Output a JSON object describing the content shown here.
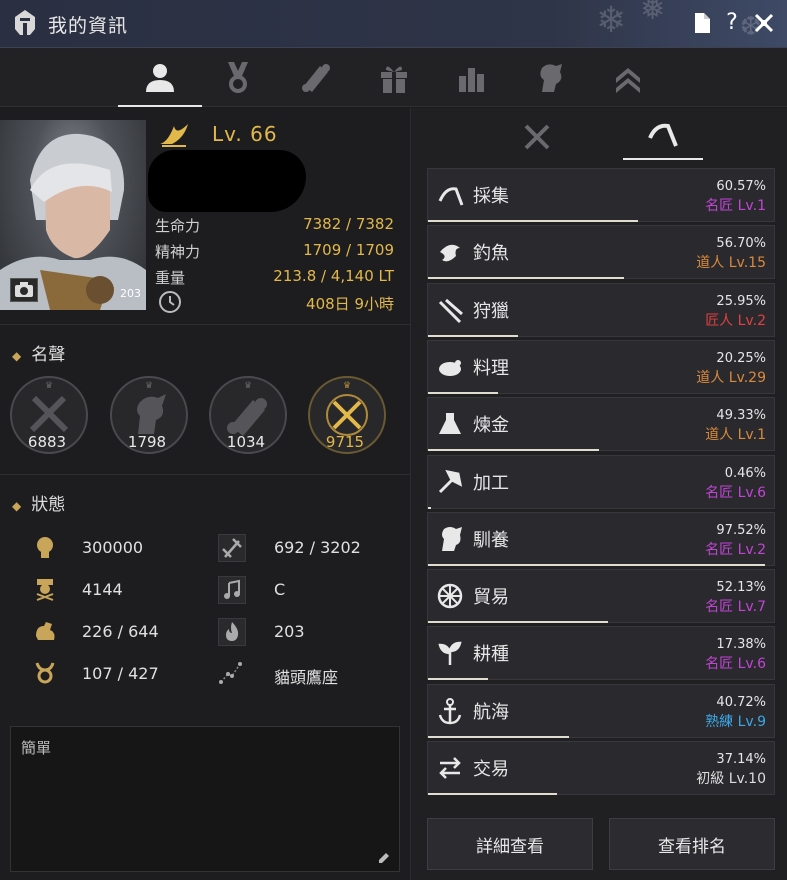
{
  "window": {
    "title": "我的資訊"
  },
  "colors": {
    "gold": "#e2b84a",
    "purple": "#c144d6",
    "orange": "#d98a3c",
    "red": "#e04040",
    "blue": "#3da7e6",
    "white": "#dddddd"
  },
  "top_tabs": [
    "profile-icon",
    "medal-icon",
    "scroll-icon",
    "gift-icon",
    "chart-icon",
    "knight-icon",
    "rank-up-icon"
  ],
  "character": {
    "level": "Lv. 66",
    "photo_badge": "203",
    "stats": [
      {
        "label": "生命力",
        "value": "7382 / 7382"
      },
      {
        "label": "精神力",
        "value": "1709 / 1709"
      },
      {
        "label": "重量",
        "value": "213.8 / 4,140 LT"
      },
      {
        "label": "",
        "value": "408日 9小時"
      }
    ]
  },
  "fame": {
    "title": "名聲",
    "items": [
      {
        "icon": "combat-icon",
        "value": "6883"
      },
      {
        "icon": "horse-icon",
        "value": "1798"
      },
      {
        "icon": "scroll-icon",
        "value": "1034"
      },
      {
        "icon": "total-icon",
        "value": "9715"
      }
    ]
  },
  "status": {
    "title": "狀態",
    "items": [
      {
        "icon": "head-icon",
        "value": "300000"
      },
      {
        "icon": "axe-icon",
        "value": "692 / 3202"
      },
      {
        "icon": "officer-icon",
        "value": "4144"
      },
      {
        "icon": "music-icon",
        "value": "C"
      },
      {
        "icon": "strength-icon",
        "value": "226 / 644"
      },
      {
        "icon": "fire-icon",
        "value": "203"
      },
      {
        "icon": "taurus-icon",
        "value": "107 / 427"
      },
      {
        "icon": "constellation-icon",
        "value": "貓頭鷹座"
      }
    ]
  },
  "memo": {
    "placeholder": "簡單"
  },
  "life_skills": [
    {
      "name": "採集",
      "percent": "60.57%",
      "grade": "名匠 Lv.1",
      "grade_color": "#c144d6",
      "progress": 0.6057
    },
    {
      "name": "釣魚",
      "percent": "56.70%",
      "grade": "道人 Lv.15",
      "grade_color": "#d98a3c",
      "progress": 0.567
    },
    {
      "name": "狩獵",
      "percent": "25.95%",
      "grade": "匠人 Lv.2",
      "grade_color": "#e04040",
      "progress": 0.2595
    },
    {
      "name": "料理",
      "percent": "20.25%",
      "grade": "道人 Lv.29",
      "grade_color": "#d98a3c",
      "progress": 0.2025
    },
    {
      "name": "煉金",
      "percent": "49.33%",
      "grade": "道人 Lv.1",
      "grade_color": "#d98a3c",
      "progress": 0.4933
    },
    {
      "name": "加工",
      "percent": "0.46%",
      "grade": "名匠 Lv.6",
      "grade_color": "#c144d6",
      "progress": 0.0046
    },
    {
      "name": "馴養",
      "percent": "97.52%",
      "grade": "名匠 Lv.2",
      "grade_color": "#c144d6",
      "progress": 0.9752
    },
    {
      "name": "貿易",
      "percent": "52.13%",
      "grade": "名匠 Lv.7",
      "grade_color": "#c144d6",
      "progress": 0.5213
    },
    {
      "name": "耕種",
      "percent": "17.38%",
      "grade": "名匠 Lv.6",
      "grade_color": "#c144d6",
      "progress": 0.1738
    },
    {
      "name": "航海",
      "percent": "40.72%",
      "grade": "熟練 Lv.9",
      "grade_color": "#3da7e6",
      "progress": 0.4072
    },
    {
      "name": "交易",
      "percent": "37.14%",
      "grade": "初級 Lv.10",
      "grade_color": "#dddddd",
      "progress": 0.3714
    }
  ],
  "buttons": {
    "details": "詳細查看",
    "ranking": "查看排名"
  }
}
